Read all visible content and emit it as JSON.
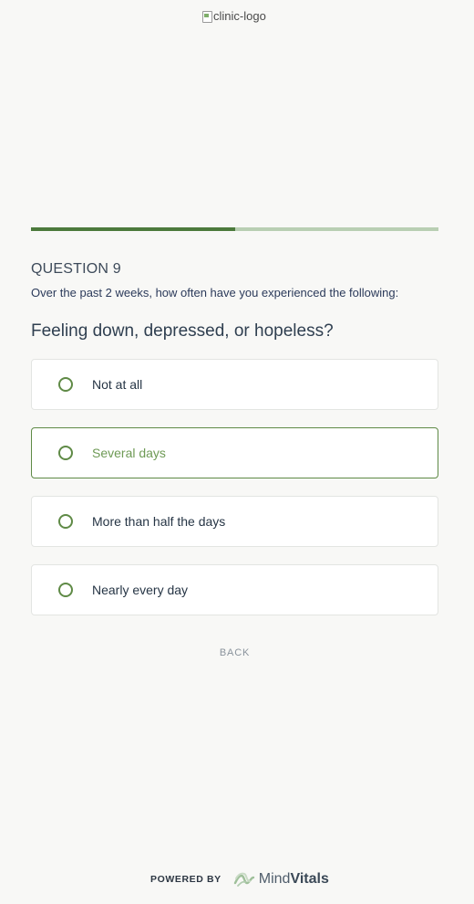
{
  "header": {
    "logo_alt": "clinic-logo"
  },
  "progress": {
    "fraction": 0.5
  },
  "question": {
    "number_label": "QUESTION 9",
    "instruction": "Over the past 2 weeks, how often have you experienced the following:",
    "text": "Feeling down, depressed, or hopeless?"
  },
  "options": [
    {
      "label": "Not at all",
      "selected": false
    },
    {
      "label": "Several days",
      "selected": true
    },
    {
      "label": "More than half the days",
      "selected": false
    },
    {
      "label": "Nearly every day",
      "selected": false
    }
  ],
  "navigation": {
    "back_label": "BACK"
  },
  "footer": {
    "powered_by": "POWERED BY",
    "brand_light": "Mind",
    "brand_bold": "Vitals"
  },
  "colors": {
    "accent": "#5f8a46",
    "progress_fill": "#4c7a3c",
    "progress_track": "#b9cfb3",
    "background": "#f8f8f6"
  },
  "icons": {
    "logo": "broken-image-icon",
    "radio": "radio-unchecked-icon",
    "brand": "mindvitals-logo-icon"
  }
}
